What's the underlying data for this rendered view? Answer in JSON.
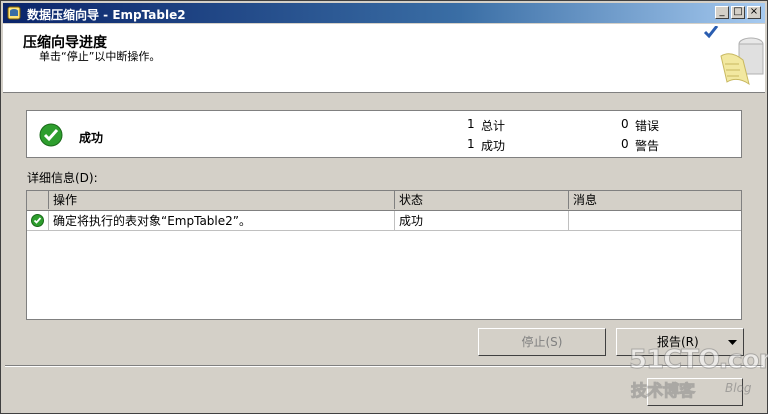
{
  "window": {
    "title": "数据压缩向导 - EmpTable2",
    "controls": [
      "_",
      "□",
      "×"
    ]
  },
  "header": {
    "title": "压缩向导进度",
    "subtitle": "单击“停止”以中断操作。"
  },
  "summary": {
    "status": "成功",
    "total_count": "1",
    "total_label": "总计",
    "success_count": "1",
    "success_label": "成功",
    "error_count": "0",
    "error_label": "错误",
    "warning_count": "0",
    "warning_label": "警告"
  },
  "details": {
    "label": "详细信息(D):",
    "columns": [
      "操作",
      "状态",
      "消息"
    ],
    "rows": [
      {
        "action": "确定将执行的表对象“EmpTable2”。",
        "status": "成功",
        "message": ""
      }
    ]
  },
  "buttons": {
    "stop": "停止(S)",
    "report": "报告(R)"
  },
  "watermark": {
    "line1": "51CTO.com",
    "line2": "技术博客",
    "line3": "Blog"
  },
  "colors": {
    "titlebar_start": "#0a246a",
    "success_green": "#2e9e2e",
    "dialog_bg": "#d4d0c8"
  }
}
